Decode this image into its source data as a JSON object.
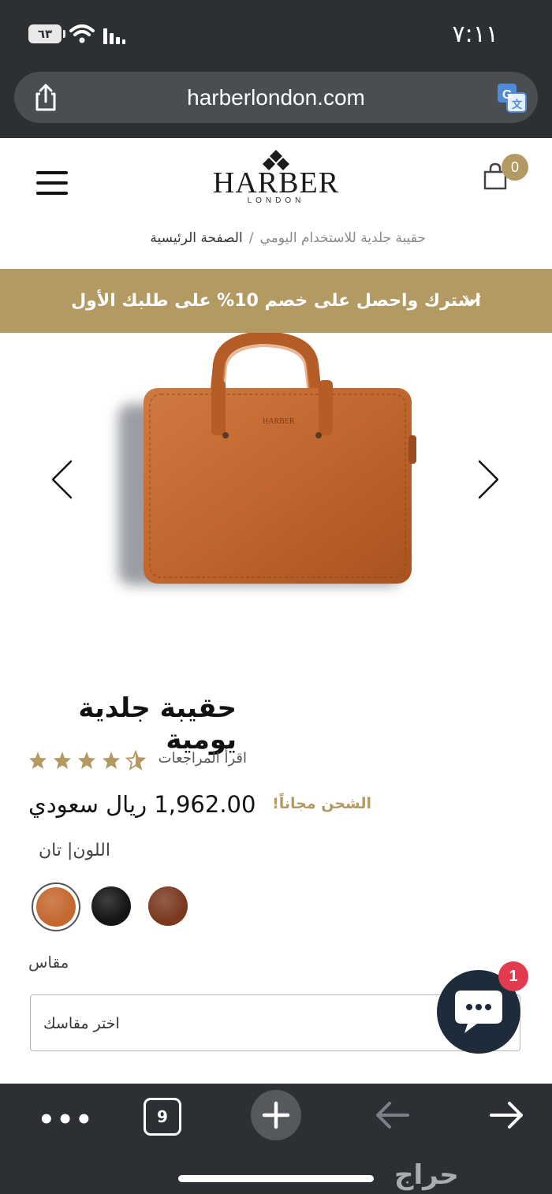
{
  "status_bar": {
    "time": "٧:١١",
    "battery": "٦٣"
  },
  "url_bar": {
    "domain": "harberlondon.com"
  },
  "header": {
    "brand": "HARBER",
    "brand_sub": "LONDON",
    "cart_count": "0"
  },
  "breadcrumb": {
    "home": "الصفحة الرئيسية",
    "separator": "/",
    "current": "حقيبة جلدية للاستخدام اليومي"
  },
  "promo": {
    "text": "اشترك واحصل على خصم 10% على طلبك الأول"
  },
  "product": {
    "title": "حقيبة جلدية يومية",
    "reviews_link": "اقرأ المراجعات",
    "rating": 4.5,
    "price": "1,962.00 ريال سعودي",
    "shipping": "الشحن مجاناً!",
    "color_label": "اللون| تان",
    "swatches": [
      {
        "name": "tan",
        "color": "#c4682f"
      },
      {
        "name": "black",
        "color": "#151515"
      },
      {
        "name": "brown",
        "color": "#7b3a20"
      }
    ],
    "size_label": "مقاس",
    "size_placeholder": "اختر مقاسك"
  },
  "chat": {
    "badge": "1"
  },
  "toolbar": {
    "more": "•••",
    "tabs_count": "9"
  },
  "watermark": "حراج"
}
